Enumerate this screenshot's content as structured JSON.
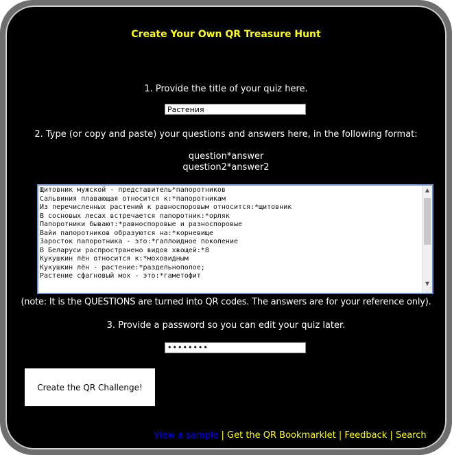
{
  "page": {
    "title": "Create Your Own QR Treasure Hunt",
    "accent_color": "#ffff00",
    "background_color": "#000000"
  },
  "step1": {
    "label": "1. Provide the title of your quiz here.",
    "value": "Растения"
  },
  "step2": {
    "label": "2. Type (or copy and paste) your questions and answers here, in the following format:",
    "format_line1": "question*answer",
    "format_line2": "question2*answer2",
    "lines": [
      "Щитовник мужской - представитель*папоротников",
      "Сальвиния плавающая относится к:*папоротникам",
      "Из перечисленных растений к равноспоровым относится:*щитовник",
      "В сосновых лесах встречается папоротник:*орляк",
      "Папоротники бывают:*равноспоровые и разноспоровые",
      "Вайи папоротников образуются на:*корневище",
      "Заросток папоротника - это:*гаплоидное поколение",
      "В Беларуси распространено видов хвощей:*8",
      "Кукушкин лён относится к:*моховидным",
      "Кукушкин лён - растение:*раздельнополое;",
      "Растение сфагновый мох - это:*гаметофит"
    ],
    "note": "(note: It is the QUESTIONS are turned into QR codes. The answers are for your reference only)."
  },
  "step3": {
    "label": "3. Provide a password so you can edit your quiz later.",
    "masked_value": "••••••••"
  },
  "create_button": "Create the QR Challenge!",
  "footer": {
    "view_sample": "View a sample",
    "bookmarklet": "Get the QR Bookmarklet",
    "feedback": "Feedback",
    "search": "Search",
    "separator": " | "
  },
  "icons": [
    "scroll-up-icon",
    "scroll-down-icon",
    "resize-grip-icon"
  ]
}
